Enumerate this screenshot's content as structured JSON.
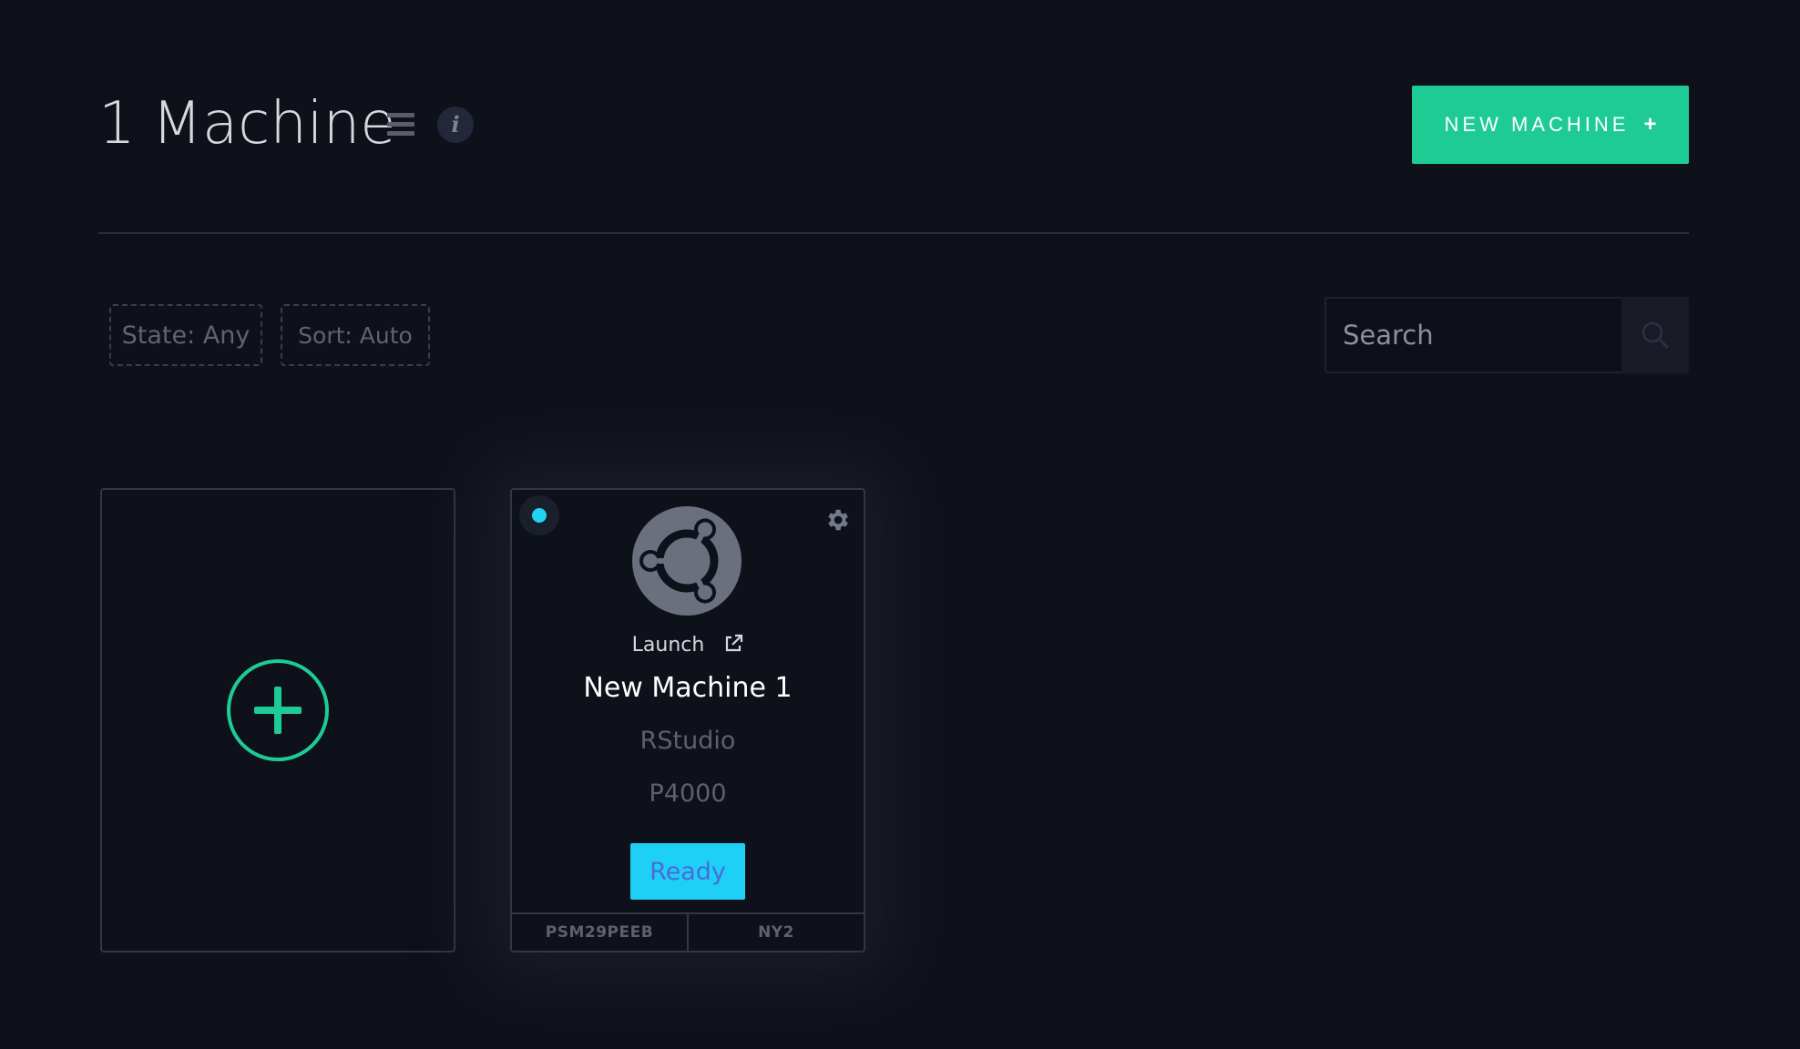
{
  "header": {
    "count": "1",
    "title": "Machine",
    "new_machine_label": "NEW MACHINE",
    "new_machine_icon": "plus-icon"
  },
  "filters": {
    "state_label": "State: Any",
    "sort_label": "Sort: Auto"
  },
  "search": {
    "placeholder": "Search",
    "icon": "search-icon"
  },
  "add_card": {
    "icon": "plus-circle-icon"
  },
  "machine": {
    "status_color": "#1fd4f0",
    "os_icon": "ubuntu-icon",
    "launch_label": "Launch",
    "name": "New Machine 1",
    "template": "RStudio",
    "gpu": "P4000",
    "status": "Ready",
    "id": "PSM29PEEB",
    "region": "NY2"
  },
  "colors": {
    "accent": "#1ecb94",
    "status_ready": "#1fd0f6",
    "background": "#0e111a"
  }
}
